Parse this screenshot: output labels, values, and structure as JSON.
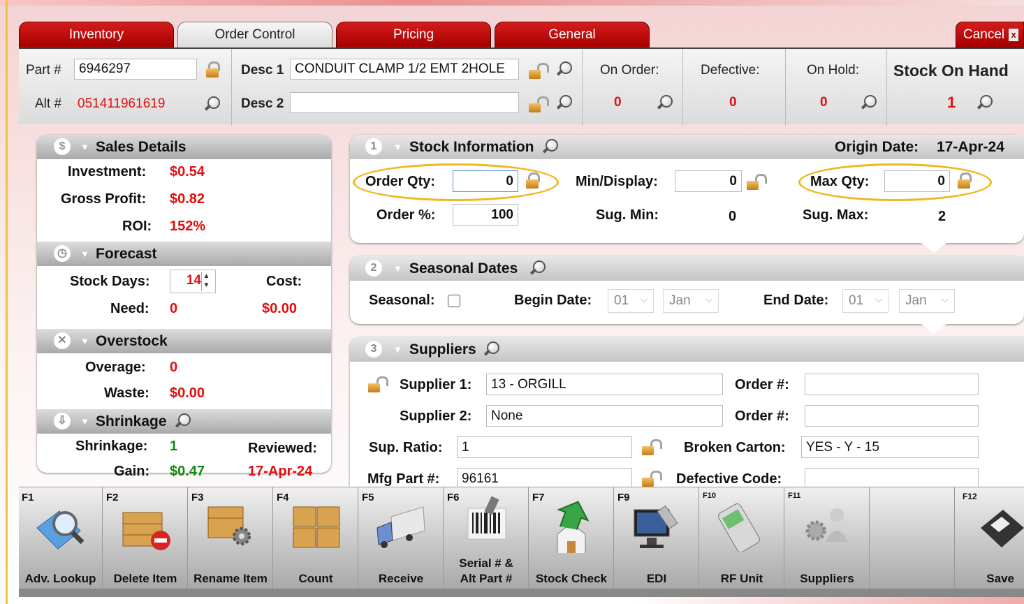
{
  "tabs": [
    {
      "label": "Inventory"
    },
    {
      "label": "Order Control"
    },
    {
      "label": "Pricing"
    },
    {
      "label": "General"
    }
  ],
  "cancel_label": "Cancel",
  "header": {
    "part_label": "Part #",
    "part_value": "6946297",
    "alt_label": "Alt #",
    "alt_value": "051411961619",
    "desc1_label": "Desc 1",
    "desc1_value": "CONDUIT CLAMP 1/2 EMT 2HOLE",
    "desc2_label": "Desc 2",
    "desc2_value": "",
    "on_order_label": "On Order:",
    "on_order_value": "0",
    "defective_label": "Defective:",
    "defective_value": "0",
    "on_hold_label": "On Hold:",
    "on_hold_value": "0",
    "stock_on_hand_label": "Stock On Hand",
    "stock_on_hand_value": "1"
  },
  "sales": {
    "title": "Sales Details",
    "investment_label": "Investment:",
    "investment_value": "$0.54",
    "gross_profit_label": "Gross Profit:",
    "gross_profit_value": "$0.82",
    "roi_label": "ROI:",
    "roi_value": "152%"
  },
  "forecast": {
    "title": "Forecast",
    "stock_days_label": "Stock Days:",
    "stock_days_value": "14",
    "cost_label": "Cost:",
    "cost_value": "$0.00",
    "need_label": "Need:",
    "need_value": "0"
  },
  "overstock": {
    "title": "Overstock",
    "overage_label": "Overage:",
    "overage_value": "0",
    "waste_label": "Waste:",
    "waste_value": "$0.00"
  },
  "shrinkage": {
    "title": "Shrinkage",
    "shrinkage_label": "Shrinkage:",
    "shrinkage_value": "1",
    "reviewed_label": "Reviewed:",
    "reviewed_value": "17-Apr-24",
    "gain_label": "Gain:",
    "gain_value": "$0.47"
  },
  "stock_info": {
    "number": "1",
    "title": "Stock Information",
    "origin_date_label": "Origin Date:",
    "origin_date_value": "17-Apr-24",
    "order_qty_label": "Order Qty:",
    "order_qty_value": "0",
    "min_display_label": "Min/Display:",
    "min_display_value": "0",
    "max_qty_label": "Max Qty:",
    "max_qty_value": "0",
    "order_pct_label": "Order %:",
    "order_pct_value": "100",
    "sug_min_label": "Sug. Min:",
    "sug_min_value": "0",
    "sug_max_label": "Sug. Max:",
    "sug_max_value": "2"
  },
  "seasonal": {
    "number": "2",
    "title": "Seasonal Dates",
    "seasonal_label": "Seasonal:",
    "begin_label": "Begin Date:",
    "begin_day": "01",
    "begin_month": "Jan",
    "end_label": "End Date:",
    "end_day": "01",
    "end_month": "Jan"
  },
  "suppliers": {
    "number": "3",
    "title": "Suppliers",
    "supplier1_label": "Supplier 1:",
    "supplier1_value": "13 - ORGILL",
    "supplier2_label": "Supplier 2:",
    "supplier2_value": "None",
    "order_num_label": "Order #:",
    "order_num1_value": "",
    "order_num2_value": "",
    "sup_ratio_label": "Sup. Ratio:",
    "sup_ratio_value": "1",
    "broken_carton_label": "Broken Carton:",
    "broken_carton_value": "YES - Y - 15",
    "mfg_part_label": "Mfg Part #:",
    "mfg_part_value": "96161",
    "defective_code_label": "Defective Code:",
    "defective_code_value": ""
  },
  "toolbar": [
    {
      "key": "F1",
      "label": "Adv. Lookup",
      "icon": "magnifier-book-icon"
    },
    {
      "key": "F2",
      "label": "Delete Item",
      "icon": "crate-delete-icon"
    },
    {
      "key": "F3",
      "label": "Rename Item",
      "icon": "crate-gear-icon"
    },
    {
      "key": "F4",
      "label": "Count",
      "icon": "crates-icon"
    },
    {
      "key": "F5",
      "label": "Receive",
      "icon": "truck-icon"
    },
    {
      "key": "F6",
      "label": "Serial # & Alt Part #",
      "icon": "barcode-scanner-icon"
    },
    {
      "key": "F7",
      "label": "Stock Check",
      "icon": "house-arrow-icon"
    },
    {
      "key": "F9",
      "label": "EDI",
      "icon": "monitor-plug-icon"
    },
    {
      "key": "F10",
      "label": "RF Unit",
      "icon": "handheld-device-icon"
    },
    {
      "key": "F11",
      "label": "Suppliers",
      "icon": "people-gear-icon"
    },
    {
      "key": "",
      "label": "",
      "icon": ""
    },
    {
      "key": "F12",
      "label": "Save",
      "icon": "floppy-disk-icon"
    }
  ]
}
